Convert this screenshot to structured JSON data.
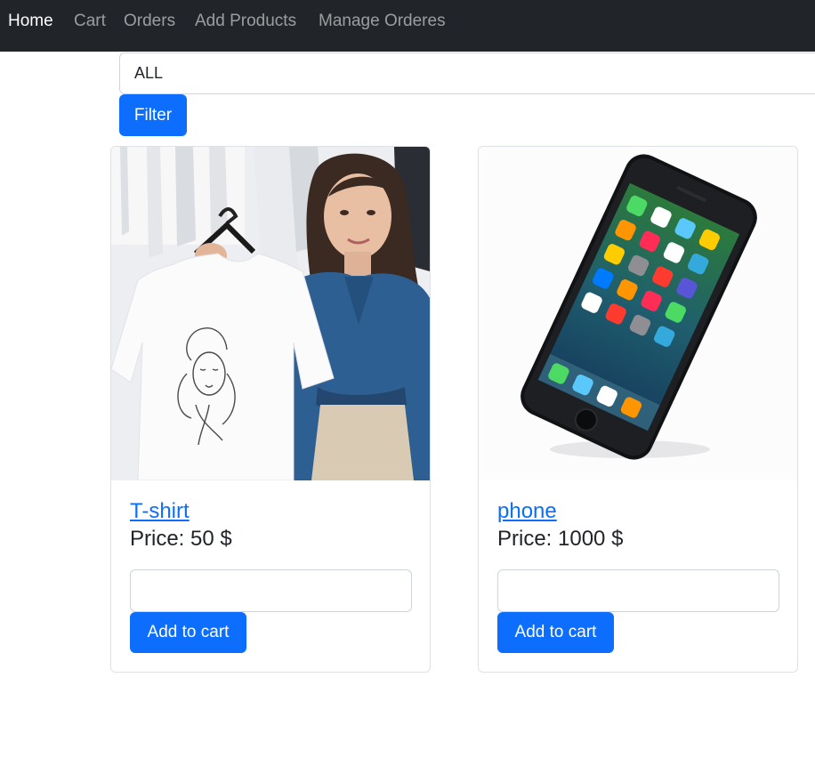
{
  "nav": {
    "items": [
      {
        "label": "Home",
        "active": true
      },
      {
        "label": "Cart",
        "active": false
      },
      {
        "label": "Orders",
        "active": false
      },
      {
        "label": "Add Products",
        "active": false
      },
      {
        "label": "Manage Orderes",
        "active": false
      }
    ]
  },
  "filter": {
    "selected_category": "ALL",
    "button_label": "Filter"
  },
  "products": [
    {
      "name": "T-shirt",
      "price": "Price: 50 $",
      "quantity_value": "",
      "add_label": "Add to cart",
      "image": "woman-holding-tshirt-photo"
    },
    {
      "name": "phone",
      "price": "Price: 1000 $",
      "quantity_value": "",
      "add_label": "Add to cart",
      "image": "smartphone-photo"
    }
  ],
  "colors": {
    "navbar_bg": "#212529",
    "primary": "#0d6efd",
    "link": "#0d6efd",
    "border": "#dee2e6"
  }
}
